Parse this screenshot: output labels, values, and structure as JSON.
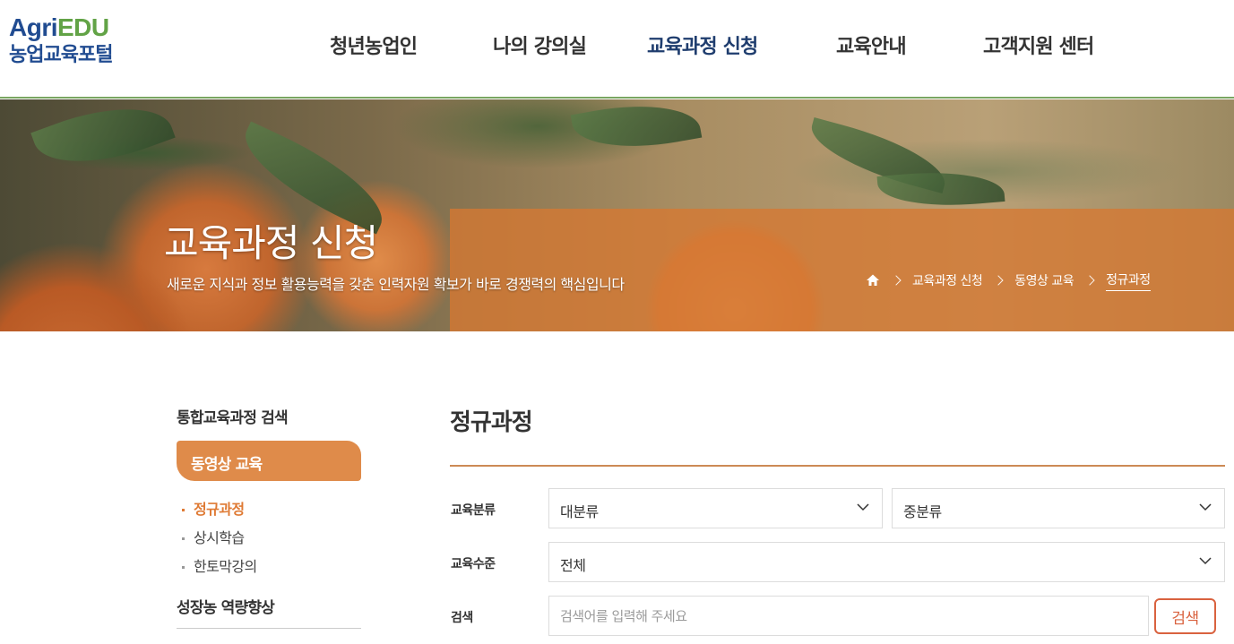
{
  "logo": {
    "top_part1": "Agri",
    "top_part2": "EDU",
    "bottom": "농업교육포털"
  },
  "nav": [
    {
      "label": "청년농업인"
    },
    {
      "label": "나의 강의실"
    },
    {
      "label": "교육과정 신청",
      "active": true
    },
    {
      "label": "교육안내"
    },
    {
      "label": "고객지원 센터"
    }
  ],
  "banner": {
    "title": "교육과정 신청",
    "subtitle": "새로운 지식과 정보 활용능력을 갖춘 인력자원 확보가 바로 경쟁력의 핵심입니다",
    "breadcrumb": [
      "교육과정 신청",
      "동영상 교육",
      "정규과정"
    ]
  },
  "sidebar": {
    "heading": "통합교육과정 검색",
    "active_item": "동영상 교육",
    "subitems": [
      "정규과정",
      "상시학습",
      "한토막강의"
    ],
    "heading2": "성장농 역량향상"
  },
  "main": {
    "title": "정규과정",
    "filters": {
      "category_label": "교육분류",
      "category_major": "대분류",
      "category_minor": "중분류",
      "level_label": "교육수준",
      "level_value": "전체",
      "search_label": "검색",
      "search_placeholder": "검색어를 입력해 주세요",
      "search_button": "검색"
    }
  },
  "colors": {
    "accent": "#df8b4a",
    "brand_blue": "#214c91",
    "brand_green": "#62a346",
    "search_red": "#d9623f"
  }
}
